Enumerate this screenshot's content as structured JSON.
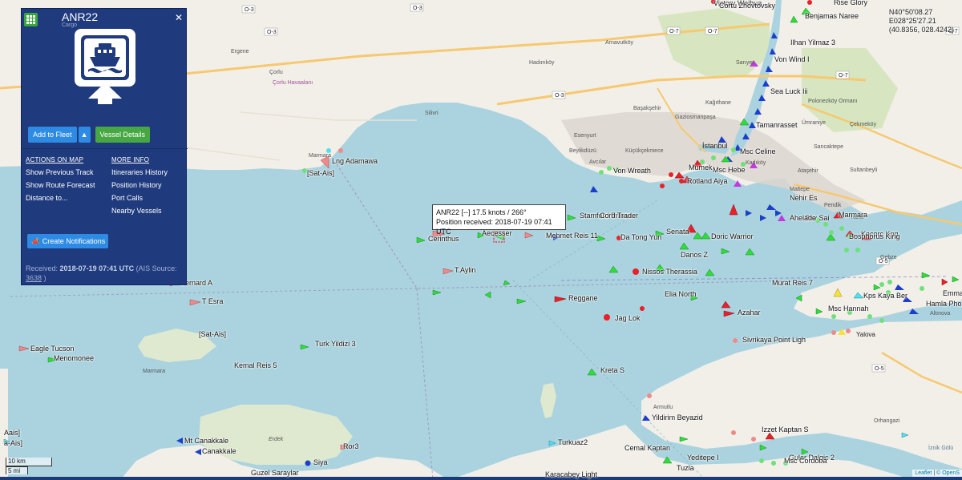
{
  "panel": {
    "vessel_name": "ANR22",
    "vessel_type": "Cargo",
    "add_to_fleet": "Add to Fleet",
    "vessel_details": "Vessel Details",
    "actions_heading": "ACTIONS ON MAP",
    "actions": [
      "Show Previous Track",
      "Show Route Forecast",
      "Distance to..."
    ],
    "more_heading": "MORE INFO",
    "more": [
      "Itineraries History",
      "Position History",
      "Port Calls",
      "Nearby Vessels"
    ],
    "create_notifications": "Create Notifications",
    "received_label": "Received:",
    "received_time": "2018-07-19 07:41 UTC",
    "ais_source_label": "(AIS Source:",
    "ais_source_id": "3638",
    "ais_source_close": ")"
  },
  "tooltip": {
    "line1": "ANR22 [--] 17.5 knots / 266°",
    "line2": "Position received: 2018-07-19 07:41 UTC"
  },
  "coords": {
    "lat": "N40°50'08.27",
    "lon": "E028°25'27.21",
    "decimal": "(40.8356, 028.4242)"
  },
  "scale": {
    "km": "10 km",
    "mi": "5 mi"
  },
  "attribution": {
    "leaflet": "Leaflet",
    "osm": "© OpenS"
  },
  "map_places": [
    "Ergene",
    "Çorlu",
    "Çorlu Havaalanı",
    "Marmara",
    "Silivri",
    "Esenyurt",
    "Beylikdüzü",
    "Küçükçekmece",
    "Avcılar",
    "Başakşehir",
    "Gaziosmanpaşa",
    "Kağıthane",
    "İstanbul",
    "Sarıyer",
    "Ümraniye",
    "Çekmeköy",
    "Sancaktepe",
    "Kadıköy",
    "Ataşehir",
    "Sultanbeyli",
    "Maltepe",
    "Pendik",
    "Tuzla",
    "Gebze",
    "Yalova",
    "Armutlu",
    "Erdek",
    "Marmara",
    "Orhangazi",
    "İznik Gölü",
    "Altınova",
    "Polonezköy Ormanı",
    "Hadımköy",
    "Arnavutköy"
  ],
  "roads": [
    "O-3",
    "O-3",
    "O-3",
    "O-3",
    "O-7",
    "O-7",
    "O-7",
    "O-7",
    "O-7",
    "O-5",
    "O-5",
    "O-4",
    "O-4"
  ],
  "vessels": [
    [
      "Victory Weihua",
      890,
      5
    ],
    [
      "Cortu Zhovtovsky",
      897,
      8
    ],
    [
      "Rise Glory",
      1040,
      4
    ],
    [
      "Benjamas Naree",
      1004,
      21
    ],
    [
      "Ilhan Yilmaz 3",
      986,
      54
    ],
    [
      "Von Wind I",
      966,
      75
    ],
    [
      "Sea Luck Iii",
      961,
      115
    ],
    [
      "Tamanrasset",
      943,
      157
    ],
    [
      "Msc Celine",
      923,
      190
    ],
    [
      "Msc Hebe",
      889,
      213
    ],
    [
      "Mumek",
      859,
      210
    ],
    [
      "Von Wreath",
      765,
      214
    ],
    [
      "Rotland Aiya",
      857,
      227
    ],
    [
      "Nehir Es",
      985,
      248
    ],
    [
      "Bkv Sai",
      1004,
      273
    ],
    [
      "Ahelade",
      985,
      273
    ],
    [
      "Marmara",
      1046,
      269
    ],
    [
      "Kacorc Kng",
      1074,
      293
    ],
    [
      "Bosphorus King",
      1059,
      296
    ],
    [
      "Stamford Prince",
      723,
      270
    ],
    [
      "Cord Trader",
      748,
      270
    ],
    [
      "Lng Adamawa",
      414,
      202
    ],
    [
      "[Sat-Ais]",
      383,
      217
    ],
    [
      "Aecesser",
      601,
      292
    ],
    [
      "Cerinthus",
      534,
      299
    ],
    [
      "Mehmet Reis 11",
      681,
      295
    ],
    [
      "Da Tong Yun",
      774,
      297
    ],
    [
      "Senata",
      831,
      290
    ],
    [
      "Doric Warrior",
      887,
      296
    ],
    [
      "Danos Z",
      849,
      319
    ],
    [
      "T.Aylin",
      567,
      338
    ],
    [
      "Nissos Therassia",
      801,
      340
    ],
    [
      "Murat Reis 7",
      963,
      354
    ],
    [
      "Emmak",
      1176,
      367
    ],
    [
      "Kps Kaya Ber",
      1077,
      370
    ],
    [
      "Hamla Phoe",
      1155,
      380
    ],
    [
      "Reggane",
      709,
      373
    ],
    [
      "Elia North",
      829,
      368
    ],
    [
      "Msc Hannah",
      1033,
      386
    ],
    [
      "Azahar",
      920,
      391
    ],
    [
      "Jag Lok",
      767,
      398
    ],
    [
      "Sivrikaya Point Ligh",
      926,
      425
    ],
    [
      "Bernard A",
      225,
      354
    ],
    [
      "T Esra",
      252,
      377
    ],
    [
      "[Sat-Ais]",
      248,
      418
    ],
    [
      "Eagle Tucson",
      38,
      436
    ],
    [
      "Menomonee",
      67,
      448
    ],
    [
      "Turk Yildizi 3",
      393,
      430
    ],
    [
      "Kemal Reis 5",
      292,
      457
    ],
    [
      "Kreta S",
      749,
      463
    ],
    [
      "Yildirim Beyazid",
      813,
      522
    ],
    [
      "Izzet Kaptan S",
      950,
      537
    ],
    [
      "Turkuaz2",
      696,
      553
    ],
    [
      "Cemal Kaptan",
      779,
      560
    ],
    [
      "Yeditepe I",
      857,
      572
    ],
    [
      "Guler Dalgic 2",
      984,
      572
    ],
    [
      "Msc Cordoba",
      978,
      576
    ],
    [
      "Tuzla",
      844,
      585
    ],
    [
      "Mt Canakkale",
      230,
      551
    ],
    [
      "Canakkale",
      252,
      564
    ],
    [
      "Siya",
      391,
      578
    ],
    [
      "Guzel Saraylar",
      313,
      591
    ],
    [
      "Karacabey Light",
      680,
      593
    ],
    [
      "Ror3",
      428,
      558
    ],
    [
      "Aais]",
      5,
      541
    ],
    [
      "a-Ais]",
      5,
      554
    ]
  ]
}
